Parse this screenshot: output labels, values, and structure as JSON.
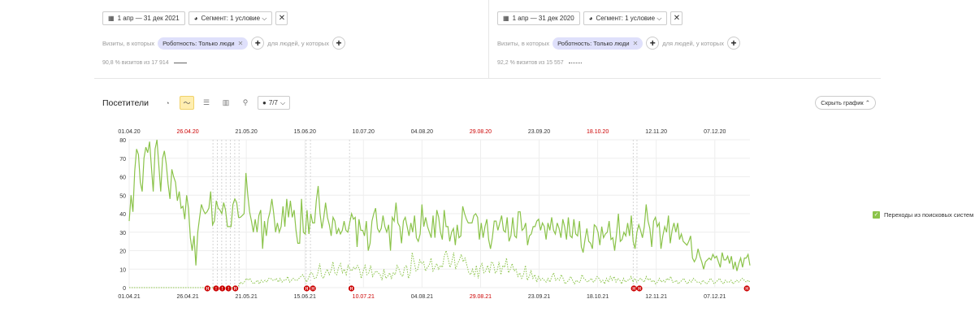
{
  "left_panel": {
    "date_range": "1 апр — 31 дек 2021",
    "segment_label": "Сегмент: 1 условие",
    "visits_where": "Визиты, в которых",
    "filter_chip": "Роботность: Только люди",
    "people_where": "для людей, у которых",
    "summary": "90,8 % визитов из 17 914"
  },
  "right_panel": {
    "date_range": "1 апр — 31 дек 2020",
    "segment_label": "Сегмент: 1 условие",
    "visits_where": "Визиты, в которых",
    "filter_chip": "Роботность: Только люди",
    "people_where": "для людей, у которых",
    "summary": "92,2 % визитов из 15 557"
  },
  "toolbar": {
    "title": "Посетители",
    "series_dropdown": "7/7",
    "hide_chart": "Скрыть график"
  },
  "legend": {
    "label": "Переходы из поисковых систем",
    "color": "#8bc34a"
  },
  "colors": {
    "accent_line": "#8bc34a",
    "holiday": "#cc0000",
    "grid": "#eeeeee"
  },
  "chart_data": {
    "type": "line",
    "y_ticks": [
      0,
      10,
      20,
      30,
      40,
      50,
      60,
      70,
      80
    ],
    "ylim": [
      0,
      80
    ],
    "top_axis_ticks": [
      {
        "label": "01.04.20",
        "red": false
      },
      {
        "label": "26.04.20",
        "red": true
      },
      {
        "label": "21.05.20",
        "red": false
      },
      {
        "label": "15.06.20",
        "red": false
      },
      {
        "label": "10.07.20",
        "red": false
      },
      {
        "label": "04.08.20",
        "red": false
      },
      {
        "label": "29.08.20",
        "red": true
      },
      {
        "label": "23.09.20",
        "red": false
      },
      {
        "label": "18.10.20",
        "red": true
      },
      {
        "label": "12.11.20",
        "red": false
      },
      {
        "label": "07.12.20",
        "red": false
      }
    ],
    "bottom_axis_ticks": [
      {
        "label": "01.04.21",
        "red": false
      },
      {
        "label": "26.04.21",
        "red": false
      },
      {
        "label": "21.05.21",
        "red": false
      },
      {
        "label": "15.06.21",
        "red": false
      },
      {
        "label": "10.07.21",
        "red": true
      },
      {
        "label": "04.08.21",
        "red": false
      },
      {
        "label": "29.08.21",
        "red": true
      },
      {
        "label": "23.09.21",
        "red": false
      },
      {
        "label": "18.10.21",
        "red": false
      },
      {
        "label": "12.11.21",
        "red": false
      },
      {
        "label": "07.12.21",
        "red": false
      }
    ],
    "series": [
      {
        "style": "solid",
        "values": [
          36,
          50,
          41,
          63,
          75,
          72,
          57,
          52,
          70,
          76,
          73,
          79,
          65,
          52,
          75,
          80,
          66,
          52,
          70,
          74,
          67,
          56,
          48,
          64,
          60,
          57,
          47,
          52,
          43,
          44,
          37,
          50,
          43,
          27,
          20,
          28,
          12,
          30,
          38,
          45,
          42,
          40,
          41,
          43,
          52,
          34,
          36,
          47,
          43,
          42,
          40,
          46,
          42,
          33,
          33,
          33,
          45,
          48,
          46,
          38,
          38,
          39,
          40,
          62,
          50,
          41,
          36,
          30,
          37,
          30,
          39,
          42,
          21,
          36,
          28,
          37,
          41,
          48,
          40,
          30,
          35,
          30,
          33,
          44,
          33,
          48,
          38,
          47,
          38,
          42,
          31,
          24,
          24,
          48,
          30,
          29,
          42,
          29,
          40,
          35,
          35,
          47,
          55,
          40,
          32,
          38,
          46,
          38,
          34,
          28,
          38,
          36,
          29,
          32,
          29,
          31,
          36,
          31,
          30,
          35,
          40,
          37,
          38,
          22,
          37,
          31,
          31,
          28,
          36,
          20,
          24,
          36,
          40,
          43,
          32,
          30,
          32,
          39,
          33,
          30,
          34,
          20,
          38,
          36,
          46,
          35,
          33,
          24,
          36,
          38,
          33,
          28,
          35,
          30,
          39,
          27,
          25,
          29,
          45,
          33,
          38,
          33,
          30,
          27,
          39,
          27,
          42,
          38,
          30,
          26,
          42,
          33,
          33,
          25,
          30,
          32,
          23,
          34,
          27,
          28,
          44,
          40,
          37,
          35,
          35,
          35,
          39,
          40,
          38,
          26,
          35,
          27,
          33,
          37,
          26,
          21,
          27,
          36,
          36,
          31,
          35,
          39,
          31,
          30,
          38,
          25,
          28,
          38,
          28,
          27,
          41,
          41,
          31,
          32,
          35,
          23,
          28,
          29,
          33,
          33,
          36,
          37,
          31,
          35,
          33,
          26,
          35,
          31,
          38,
          31,
          29,
          35,
          32,
          27,
          37,
          33,
          26,
          38,
          28,
          27,
          37,
          29,
          28,
          36,
          22,
          19,
          26,
          32,
          25,
          24,
          21,
          34,
          33,
          30,
          23,
          33,
          27,
          29,
          30,
          36,
          26,
          27,
          20,
          29,
          40,
          25,
          26,
          30,
          28,
          35,
          28,
          39,
          25,
          21,
          30,
          34,
          31,
          27,
          33,
          45,
          36,
          32,
          22,
          36,
          38,
          33,
          35,
          21,
          28,
          33,
          30,
          39,
          24,
          31,
          35,
          30,
          35,
          26,
          29,
          25,
          24,
          23,
          25,
          28,
          16,
          14,
          16,
          21,
          17,
          14,
          10,
          14,
          15,
          16,
          15,
          18,
          16,
          17,
          14,
          11,
          19,
          15,
          15,
          17,
          13,
          17,
          10,
          14,
          9,
          13,
          16,
          11,
          16,
          16,
          18,
          12
        ]
      },
      {
        "style": "dotted",
        "values": [
          0,
          0,
          0,
          0,
          0,
          0,
          0,
          0,
          0,
          0,
          0,
          0,
          0,
          0,
          0,
          0,
          0,
          0,
          0,
          0,
          0,
          0,
          0,
          0,
          0,
          0,
          0,
          0,
          0,
          0,
          0,
          0,
          0,
          0,
          0,
          0,
          0,
          0,
          0,
          0,
          0,
          0,
          0,
          0,
          0,
          0,
          0,
          0,
          0,
          0,
          0,
          0,
          0,
          0,
          0,
          0,
          0,
          0,
          1,
          3,
          2,
          3,
          5,
          4,
          5,
          3,
          2,
          3,
          4,
          2,
          4,
          3,
          4,
          3,
          5,
          5,
          4,
          4,
          5,
          3,
          5,
          3,
          4,
          4,
          6,
          3,
          4,
          5,
          4,
          4,
          5,
          6,
          7,
          5,
          3,
          5,
          8,
          8,
          5,
          5,
          8,
          13,
          6,
          5,
          8,
          10,
          7,
          9,
          14,
          8,
          7,
          11,
          13,
          8,
          10,
          7,
          12,
          10,
          9,
          11,
          10,
          12,
          10,
          5,
          9,
          12,
          7,
          8,
          12,
          6,
          8,
          9,
          8,
          7,
          4,
          10,
          5,
          6,
          8,
          5,
          8,
          7,
          12,
          10,
          7,
          6,
          11,
          12,
          5,
          8,
          19,
          14,
          9,
          10,
          15,
          13,
          14,
          9,
          11,
          12,
          16,
          9,
          11,
          13,
          10,
          12,
          11,
          17,
          20,
          16,
          11,
          14,
          19,
          10,
          13,
          15,
          18,
          14,
          16,
          12,
          8,
          7,
          10,
          6,
          12,
          5,
          11,
          13,
          8,
          9,
          12,
          8,
          14,
          13,
          8,
          9,
          14,
          7,
          12,
          11,
          16,
          8,
          10,
          13,
          9,
          10,
          6,
          8,
          5,
          7,
          12,
          4,
          6,
          9,
          5,
          7,
          3,
          6,
          4,
          5,
          4,
          3,
          5,
          3,
          6,
          8,
          4,
          5,
          4,
          7,
          5,
          2,
          3,
          4,
          6,
          4,
          2,
          4,
          3,
          3,
          7,
          5,
          4,
          3,
          4,
          5,
          3,
          4,
          6,
          5,
          3,
          4,
          2,
          5,
          3,
          6,
          4,
          6,
          3,
          5,
          4,
          2,
          5,
          3,
          4,
          4,
          6,
          3,
          5,
          3,
          4,
          5,
          4,
          3,
          6,
          4,
          5,
          3,
          4,
          2,
          3,
          5,
          3,
          4,
          3,
          5,
          4,
          6,
          3,
          3,
          4,
          2,
          3,
          4,
          5,
          3,
          2,
          4,
          3,
          5,
          4,
          3,
          3,
          2,
          4,
          3,
          2,
          3,
          5,
          4,
          2,
          3,
          4,
          5,
          3,
          2,
          4,
          3,
          3,
          4,
          2,
          3,
          4,
          3,
          4,
          5,
          4,
          3,
          4,
          3
        ]
      }
    ],
    "annotation_markers": [
      {
        "text": "H"
      },
      {
        "text": "!"
      },
      {
        "text": "!"
      },
      {
        "text": "!"
      },
      {
        "text": "H"
      },
      {
        "text": "H"
      },
      {
        "text": "H"
      },
      {
        "text": "H"
      },
      {
        "text": "H"
      },
      {
        "text": "H"
      },
      {
        "text": "H"
      }
    ]
  }
}
